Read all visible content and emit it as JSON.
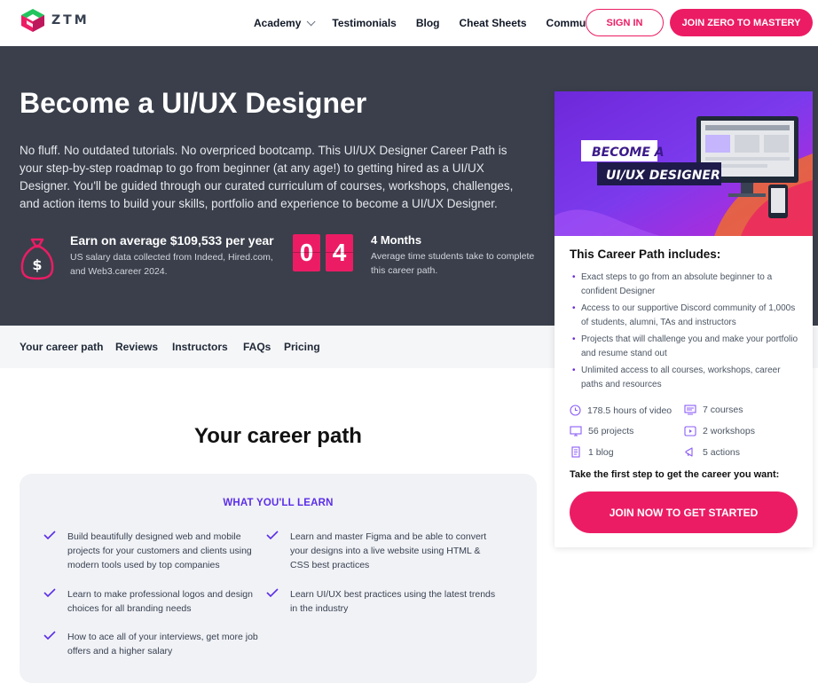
{
  "brand": {
    "name": "ZTM",
    "logo_icon": "ztm-logo-icon"
  },
  "nav": {
    "items": [
      {
        "label": "Academy",
        "has_dropdown": true
      },
      {
        "label": "Testimonials"
      },
      {
        "label": "Blog"
      },
      {
        "label": "Cheat Sheets"
      },
      {
        "label": "Community"
      }
    ],
    "signin_label": "SIGN IN",
    "join_label": "JOIN ZERO TO MASTERY"
  },
  "hero": {
    "title": "Become a UI/UX Designer",
    "description": "No fluff. No outdated tutorials. No overpriced bootcamp. This UI/UX Designer Career Path is your step-by-step roadmap to go from beginner (at any age!) to getting hired as a UI/UX Designer. You'll be guided through our curated curriculum of courses, workshops, challenges, and action items to build your skills, portfolio and experience to become a UI/UX Designer.",
    "salary": {
      "title": "Earn on average $109,533 per year",
      "subtitle": "US salary data collected from Indeed, Hired.com, and Web3.career 2024.",
      "icon": "money-bag-icon"
    },
    "duration": {
      "digits": [
        "0",
        "4"
      ],
      "title": "4 Months",
      "subtitle": "Average time students take to complete this career path."
    }
  },
  "subnav": {
    "items": [
      "Your career path",
      "Reviews",
      "Instructors",
      "FAQs",
      "Pricing"
    ]
  },
  "career_path": {
    "title": "Your career path",
    "learn_heading": "WHAT YOU'LL LEARN",
    "learn_items": [
      "Build beautifully designed web and mobile projects for your customers and clients using modern tools used by top companies",
      "Learn and master Figma and be able to convert your designs into a live website using HTML & CSS best practices",
      "Learn to make professional logos and design choices for all branding needs",
      "Learn UI/UX best practices using the latest trends in the industry",
      "How to ace all of your interviews, get more job offers and a higher salary"
    ]
  },
  "card": {
    "banner_line1": "BECOME A",
    "banner_line2": "UI/UX DESIGNER",
    "heading": "This Career Path includes:",
    "includes": [
      "Exact steps to go from an absolute beginner to a confident Designer",
      "Access to our supportive Discord community of 1,000s of students, alumni, TAs and instructors",
      "Projects that will challenge you and make your portfolio and resume stand out",
      "Unlimited access to all courses, workshops, career paths and resources"
    ],
    "features": [
      {
        "label": "178.5 hours of video",
        "icon": "clock-icon"
      },
      {
        "label": "7 courses",
        "icon": "courses-icon"
      },
      {
        "label": "56 projects",
        "icon": "monitor-icon"
      },
      {
        "label": "2 workshops",
        "icon": "play-icon"
      },
      {
        "label": "1 blog",
        "icon": "document-icon"
      },
      {
        "label": "5 actions",
        "icon": "megaphone-icon"
      }
    ],
    "cta_text": "Take the first step to get the career you want:",
    "button_label": "JOIN NOW TO GET STARTED"
  },
  "colors": {
    "accent": "#ec1c64",
    "purple": "#5b2ee8",
    "hero_bg": "#3a3f4b"
  }
}
